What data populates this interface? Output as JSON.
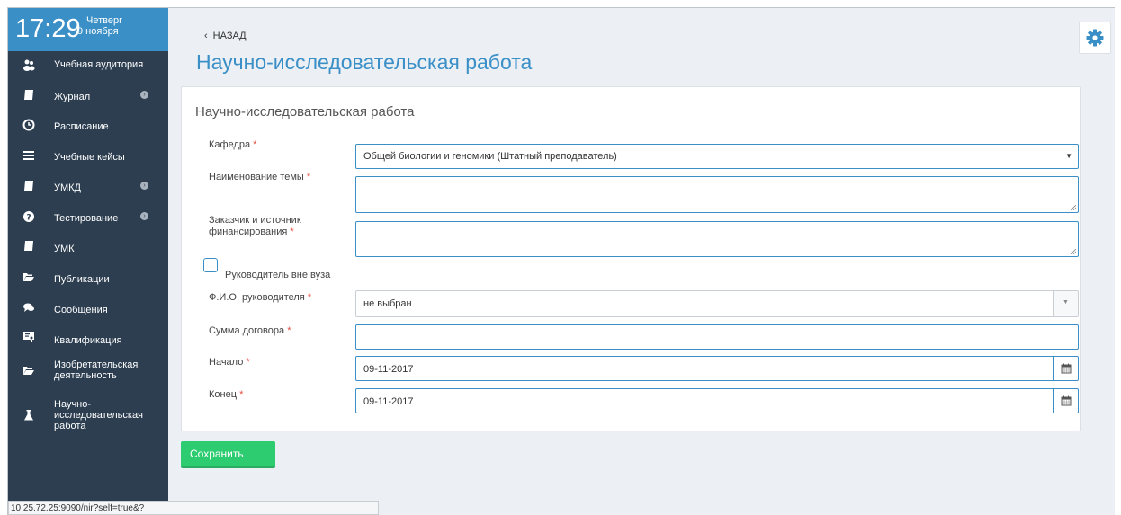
{
  "clock": {
    "time": "17:29",
    "weekday": "Четверг",
    "date": "9 ноября"
  },
  "sidebar": {
    "items": [
      {
        "label": "Учебная аудитория",
        "icon": "users-icon"
      },
      {
        "label": "Журнал",
        "icon": "book-icon",
        "has_submenu": true
      },
      {
        "label": "Расписание",
        "icon": "clock-icon"
      },
      {
        "label": "Учебные кейсы",
        "icon": "list-icon"
      },
      {
        "label": "УМКД",
        "icon": "book-icon",
        "has_submenu": true
      },
      {
        "label": "Тестирование",
        "icon": "question-icon",
        "has_submenu": true
      },
      {
        "label": "УМК",
        "icon": "book-icon"
      },
      {
        "label": "Публикации",
        "icon": "folder-open-icon"
      },
      {
        "label": "Сообщения",
        "icon": "comments-icon"
      },
      {
        "label": "Квалификация",
        "icon": "certificate-icon"
      },
      {
        "label": "Изобретательская деятельность",
        "icon": "folder-open-icon"
      },
      {
        "label": "Научно-исследовательская работа",
        "icon": "flask-icon"
      }
    ]
  },
  "header": {
    "back_label": "НАЗАД",
    "page_title": "Научно-исследовательская работа"
  },
  "form": {
    "title": "Научно-исследовательская работа",
    "required_mark": "*",
    "department_label": "Кафедра",
    "department_value": "Общей биологии и геномики (Штатный преподаватель)",
    "topic_label": "Наименование темы",
    "topic_value": "",
    "customer_label": "Заказчик и источник финансирования",
    "customer_value": "",
    "external_supervisor_label": "Руководитель вне вуза",
    "external_supervisor_checked": false,
    "supervisor_label": "Ф.И.О. руководителя",
    "supervisor_value": "не выбран",
    "amount_label": "Сумма договора",
    "amount_value": "",
    "start_label": "Начало",
    "start_value": "09-11-2017",
    "end_label": "Конец",
    "end_value": "09-11-2017",
    "save_label": "Сохранить"
  },
  "status_bar": {
    "url": "10.25.72.25:9090/nir?self=true&?"
  },
  "colors": {
    "sidebar_bg": "#2c3e50",
    "accent": "#3a8fc7",
    "save_button": "#2ecc71",
    "required": "#e74c3c"
  }
}
